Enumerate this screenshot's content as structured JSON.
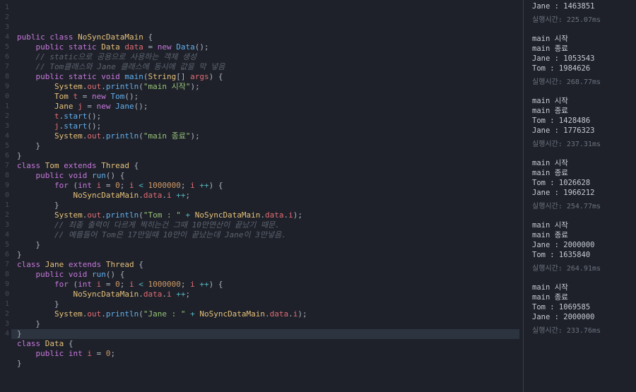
{
  "code": {
    "lines": [
      [
        [
          "kw",
          "public"
        ],
        [
          "pl",
          " "
        ],
        [
          "kw",
          "class"
        ],
        [
          "pl",
          " "
        ],
        [
          "typ",
          "NoSyncDataMain"
        ],
        [
          "pl",
          " {"
        ]
      ],
      [
        [
          "pl",
          "    "
        ],
        [
          "kw",
          "public"
        ],
        [
          "pl",
          " "
        ],
        [
          "kw",
          "static"
        ],
        [
          "pl",
          " "
        ],
        [
          "typ",
          "Data"
        ],
        [
          "pl",
          " "
        ],
        [
          "ident",
          "data"
        ],
        [
          "pl",
          " = "
        ],
        [
          "kw",
          "new"
        ],
        [
          "pl",
          " "
        ],
        [
          "fn",
          "Data"
        ],
        [
          "pl",
          "();"
        ]
      ],
      [
        [
          "pl",
          "    "
        ],
        [
          "cmt",
          "// static으로 공용으로 사용하는 객체 생성"
        ]
      ],
      [
        [
          "pl",
          "    "
        ],
        [
          "cmt",
          "// Tom클래스와 Jane 클래스에 동시에 값을 막 넣음"
        ]
      ],
      [
        [
          "pl",
          "    "
        ],
        [
          "kw",
          "public"
        ],
        [
          "pl",
          " "
        ],
        [
          "kw",
          "static"
        ],
        [
          "pl",
          " "
        ],
        [
          "kw",
          "void"
        ],
        [
          "pl",
          " "
        ],
        [
          "fn",
          "main"
        ],
        [
          "pl",
          "("
        ],
        [
          "typ",
          "String"
        ],
        [
          "pl",
          "[] "
        ],
        [
          "ident",
          "args"
        ],
        [
          "pl",
          ") {"
        ]
      ],
      [
        [
          "pl",
          "        "
        ],
        [
          "typ",
          "System"
        ],
        [
          "pl",
          "."
        ],
        [
          "ident",
          "out"
        ],
        [
          "pl",
          "."
        ],
        [
          "fn",
          "println"
        ],
        [
          "pl",
          "("
        ],
        [
          "str",
          "\"main 시작\""
        ],
        [
          "pl",
          ");"
        ]
      ],
      [
        [
          "pl",
          "        "
        ],
        [
          "typ",
          "Tom"
        ],
        [
          "pl",
          " "
        ],
        [
          "ident",
          "t"
        ],
        [
          "pl",
          " = "
        ],
        [
          "kw",
          "new"
        ],
        [
          "pl",
          " "
        ],
        [
          "fn",
          "Tom"
        ],
        [
          "pl",
          "();"
        ]
      ],
      [
        [
          "pl",
          "        "
        ],
        [
          "typ",
          "Jane"
        ],
        [
          "pl",
          " "
        ],
        [
          "ident",
          "j"
        ],
        [
          "pl",
          " = "
        ],
        [
          "kw",
          "new"
        ],
        [
          "pl",
          " "
        ],
        [
          "fn",
          "Jane"
        ],
        [
          "pl",
          "();"
        ]
      ],
      [
        [
          "pl",
          "        "
        ],
        [
          "ident",
          "t"
        ],
        [
          "pl",
          "."
        ],
        [
          "fn",
          "start"
        ],
        [
          "pl",
          "();"
        ]
      ],
      [
        [
          "pl",
          "        "
        ],
        [
          "ident",
          "j"
        ],
        [
          "pl",
          "."
        ],
        [
          "fn",
          "start"
        ],
        [
          "pl",
          "();"
        ]
      ],
      [
        [
          "pl",
          "        "
        ],
        [
          "typ",
          "System"
        ],
        [
          "pl",
          "."
        ],
        [
          "ident",
          "out"
        ],
        [
          "pl",
          "."
        ],
        [
          "fn",
          "println"
        ],
        [
          "pl",
          "("
        ],
        [
          "str",
          "\"main 종료\""
        ],
        [
          "pl",
          ");"
        ]
      ],
      [
        [
          "pl",
          "    }"
        ]
      ],
      [
        [
          "pl",
          "}"
        ]
      ],
      [
        [
          "kw",
          "class"
        ],
        [
          "pl",
          " "
        ],
        [
          "typ",
          "Tom"
        ],
        [
          "pl",
          " "
        ],
        [
          "kw",
          "extends"
        ],
        [
          "pl",
          " "
        ],
        [
          "typ",
          "Thread"
        ],
        [
          "pl",
          " {"
        ]
      ],
      [
        [
          "pl",
          "    "
        ],
        [
          "kw",
          "public"
        ],
        [
          "pl",
          " "
        ],
        [
          "kw",
          "void"
        ],
        [
          "pl",
          " "
        ],
        [
          "fn",
          "run"
        ],
        [
          "pl",
          "() {"
        ]
      ],
      [
        [
          "pl",
          "        "
        ],
        [
          "kw",
          "for"
        ],
        [
          "pl",
          " ("
        ],
        [
          "kw",
          "int"
        ],
        [
          "pl",
          " "
        ],
        [
          "ident",
          "i"
        ],
        [
          "pl",
          " = "
        ],
        [
          "num",
          "0"
        ],
        [
          "pl",
          "; "
        ],
        [
          "ident",
          "i"
        ],
        [
          "pl",
          " "
        ],
        [
          "op",
          "<"
        ],
        [
          "pl",
          " "
        ],
        [
          "num",
          "1000000"
        ],
        [
          "pl",
          "; "
        ],
        [
          "ident",
          "i"
        ],
        [
          "pl",
          " "
        ],
        [
          "op",
          "++"
        ],
        [
          "pl",
          ") {"
        ]
      ],
      [
        [
          "pl",
          "            "
        ],
        [
          "typ",
          "NoSyncDataMain"
        ],
        [
          "pl",
          "."
        ],
        [
          "ident",
          "data"
        ],
        [
          "pl",
          "."
        ],
        [
          "ident",
          "i"
        ],
        [
          "pl",
          " "
        ],
        [
          "op",
          "++"
        ],
        [
          "pl",
          ";"
        ]
      ],
      [
        [
          "pl",
          "        }"
        ]
      ],
      [
        [
          "pl",
          "        "
        ],
        [
          "typ",
          "System"
        ],
        [
          "pl",
          "."
        ],
        [
          "ident",
          "out"
        ],
        [
          "pl",
          "."
        ],
        [
          "fn",
          "println"
        ],
        [
          "pl",
          "("
        ],
        [
          "str",
          "\"Tom : \""
        ],
        [
          "pl",
          " "
        ],
        [
          "op",
          "+"
        ],
        [
          "pl",
          " "
        ],
        [
          "typ",
          "NoSyncDataMain"
        ],
        [
          "pl",
          "."
        ],
        [
          "ident",
          "data"
        ],
        [
          "pl",
          "."
        ],
        [
          "ident",
          "i"
        ],
        [
          "pl",
          ");"
        ]
      ],
      [
        [
          "pl",
          "        "
        ],
        [
          "cmt",
          "// 최종 출력이 다르게 찍히는건 그때 10만연산이 끝났기 때문."
        ]
      ],
      [
        [
          "pl",
          "        "
        ],
        [
          "cmt",
          "// 예를들어 Tom은 17만일때 10만이 끝났는데 Jane이 3만넣음."
        ]
      ],
      [
        [
          "pl",
          "    }"
        ]
      ],
      [
        [
          "pl",
          "}"
        ]
      ],
      [
        [
          "kw",
          "class"
        ],
        [
          "pl",
          " "
        ],
        [
          "typ",
          "Jane"
        ],
        [
          "pl",
          " "
        ],
        [
          "kw",
          "extends"
        ],
        [
          "pl",
          " "
        ],
        [
          "typ",
          "Thread"
        ],
        [
          "pl",
          " {"
        ]
      ],
      [
        [
          "pl",
          "    "
        ],
        [
          "kw",
          "public"
        ],
        [
          "pl",
          " "
        ],
        [
          "kw",
          "void"
        ],
        [
          "pl",
          " "
        ],
        [
          "fn",
          "run"
        ],
        [
          "pl",
          "() {"
        ]
      ],
      [
        [
          "pl",
          "        "
        ],
        [
          "kw",
          "for"
        ],
        [
          "pl",
          " ("
        ],
        [
          "kw",
          "int"
        ],
        [
          "pl",
          " "
        ],
        [
          "ident",
          "i"
        ],
        [
          "pl",
          " = "
        ],
        [
          "num",
          "0"
        ],
        [
          "pl",
          "; "
        ],
        [
          "ident",
          "i"
        ],
        [
          "pl",
          " "
        ],
        [
          "op",
          "<"
        ],
        [
          "pl",
          " "
        ],
        [
          "num",
          "1000000"
        ],
        [
          "pl",
          "; "
        ],
        [
          "ident",
          "i"
        ],
        [
          "pl",
          " "
        ],
        [
          "op",
          "++"
        ],
        [
          "pl",
          ") {"
        ]
      ],
      [
        [
          "pl",
          "            "
        ],
        [
          "typ",
          "NoSyncDataMain"
        ],
        [
          "pl",
          "."
        ],
        [
          "ident",
          "data"
        ],
        [
          "pl",
          "."
        ],
        [
          "ident",
          "i"
        ],
        [
          "pl",
          " "
        ],
        [
          "op",
          "++"
        ],
        [
          "pl",
          ";"
        ]
      ],
      [
        [
          "pl",
          "        }"
        ]
      ],
      [
        [
          "pl",
          "        "
        ],
        [
          "typ",
          "System"
        ],
        [
          "pl",
          "."
        ],
        [
          "ident",
          "out"
        ],
        [
          "pl",
          "."
        ],
        [
          "fn",
          "println"
        ],
        [
          "pl",
          "("
        ],
        [
          "str",
          "\"Jane : \""
        ],
        [
          "pl",
          " "
        ],
        [
          "op",
          "+"
        ],
        [
          "pl",
          " "
        ],
        [
          "typ",
          "NoSyncDataMain"
        ],
        [
          "pl",
          "."
        ],
        [
          "ident",
          "data"
        ],
        [
          "pl",
          "."
        ],
        [
          "ident",
          "i"
        ],
        [
          "pl",
          ");"
        ]
      ],
      [
        [
          "pl",
          "    }"
        ]
      ],
      [
        [
          "pl",
          "}"
        ]
      ],
      [
        [
          "kw",
          "class"
        ],
        [
          "pl",
          " "
        ],
        [
          "typ",
          "Data"
        ],
        [
          "pl",
          " {"
        ]
      ],
      [
        [
          "pl",
          "    "
        ],
        [
          "kw",
          "public"
        ],
        [
          "pl",
          " "
        ],
        [
          "kw",
          "int"
        ],
        [
          "pl",
          " "
        ],
        [
          "ident",
          "i"
        ],
        [
          "pl",
          " = "
        ],
        [
          "num",
          "0"
        ],
        [
          "pl",
          ";"
        ]
      ],
      [
        [
          "pl",
          "}"
        ]
      ]
    ],
    "active_line": 34,
    "start_line": 1
  },
  "output": {
    "runs": [
      {
        "lines": [
          "Jane : 1463851"
        ],
        "time": "실행시간: 225.07ms"
      },
      {
        "lines": [
          "main 시작",
          "main 종료",
          "Jane : 1053543",
          "Tom : 1984626"
        ],
        "time": "실행시간: 268.77ms"
      },
      {
        "lines": [
          "main 시작",
          "main 종료",
          "Tom : 1428486",
          "Jane : 1776323"
        ],
        "time": "실행시간: 237.31ms"
      },
      {
        "lines": [
          "main 시작",
          "main 종료",
          "Tom : 1026628",
          "Jane : 1966212"
        ],
        "time": "실행시간: 254.77ms"
      },
      {
        "lines": [
          "main 시작",
          "main 종료",
          "Jane : 2000000",
          "Tom : 1635840"
        ],
        "time": "실행시간: 264.91ms"
      },
      {
        "lines": [
          "main 시작",
          "main 종료",
          "Tom : 1069585",
          "Jane : 2000000"
        ],
        "time": "실행시간: 233.76ms"
      }
    ]
  }
}
